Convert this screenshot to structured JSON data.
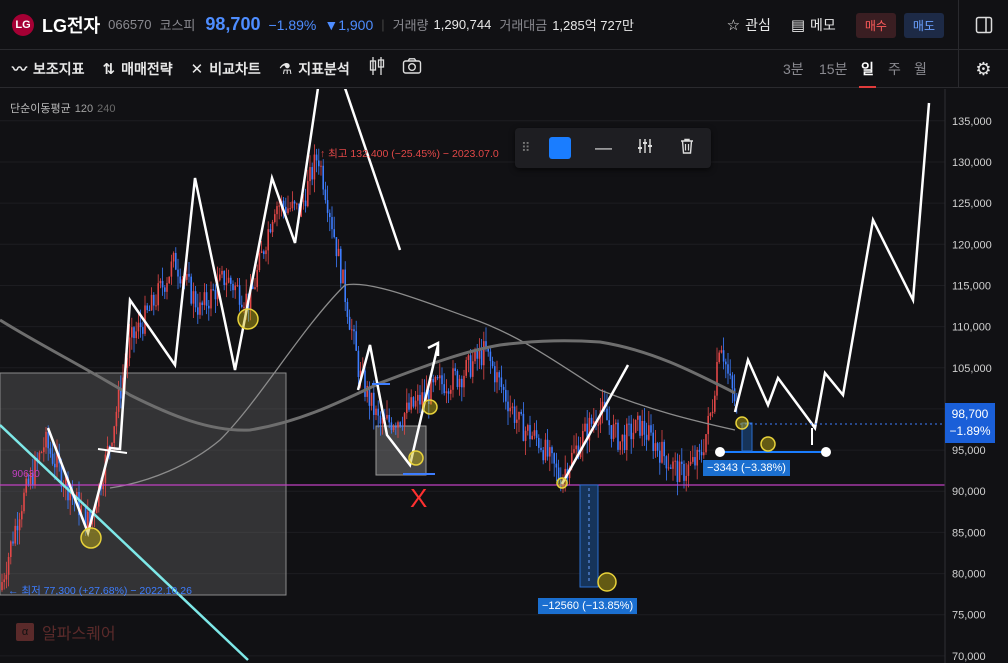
{
  "header": {
    "logo_text": "LG",
    "stock_name": "LG전자",
    "stock_code": "066570",
    "market": "코스피",
    "price": "98,700",
    "change_pct": "−1.89%",
    "change_abs": "▼1,900",
    "volume_label": "거래량",
    "volume_value": "1,290,744",
    "amount_label": "거래대금",
    "amount_value": "1,285억 727만",
    "interest_label": "관심",
    "memo_label": "메모",
    "buy_label": "매수",
    "sell_label": "매도"
  },
  "toolbar": {
    "indicator_label": "보조지표",
    "strategy_label": "매매전략",
    "compare_label": "비교차트",
    "analysis_label": "지표분석",
    "timeframes": [
      "3분",
      "15분",
      "일",
      "주",
      "월"
    ],
    "active_timeframe": "일"
  },
  "chart_overlay": {
    "ma_label": "단순이동평균",
    "ma_period_1": "120",
    "ma_period_2": "240",
    "high_annotation": "최고 132,400 (−25.45%) − 2023.07.0",
    "low_annotation": "최저 77,300 (+27.68%) − 2022.10.26",
    "level_label": "90630",
    "measure_1": "−3343  (−3.38%)",
    "measure_2": "−12560  (−13.85%)",
    "last_price": "98,700",
    "last_pct": "−1.89%",
    "watermark": "알파스퀘어",
    "watermark_icon": "α",
    "colors": {
      "up": "#e24848",
      "down": "#3d7dff",
      "accent": "#1a7dff",
      "level_line": "#c040c0",
      "trend_line": "#7ee8e8"
    }
  },
  "chart_data": {
    "type": "line",
    "y_ticks": [
      "135,000",
      "130,000",
      "125,000",
      "120,000",
      "115,000",
      "110,000",
      "105,000",
      "100,000",
      "95,000",
      "90,000",
      "85,000",
      "80,000",
      "75,000",
      "70,000"
    ],
    "ylim": [
      69500,
      138500
    ],
    "level_value": 90630,
    "last_value": 98700
  }
}
